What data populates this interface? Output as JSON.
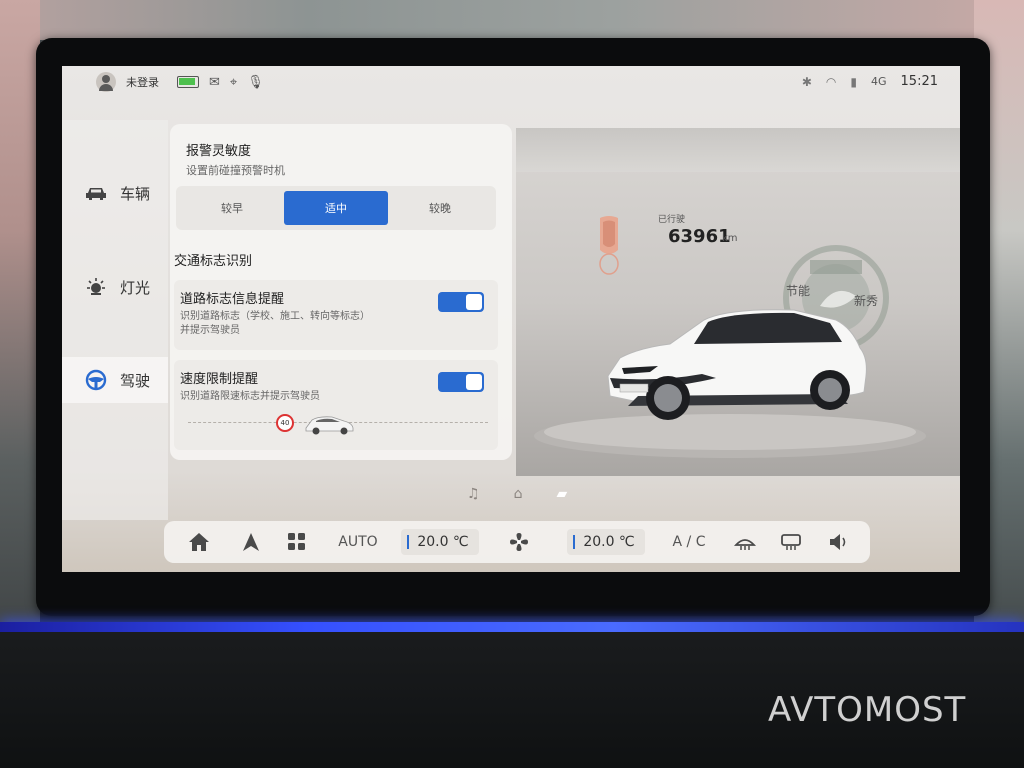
{
  "status_bar": {
    "login_label": "未登录",
    "icons": [
      "avatar-icon",
      "battery-icon",
      "mail-icon",
      "location-icon",
      "microphone-icon"
    ],
    "right_icons": [
      "bluetooth-icon",
      "wifi-icon",
      "signal-icon"
    ],
    "network": "4G",
    "time": "15:21"
  },
  "sidebar": {
    "items": [
      {
        "label": "车辆",
        "icon": "car-icon",
        "active": false
      },
      {
        "label": "灯光",
        "icon": "light-icon",
        "active": false
      },
      {
        "label": "驾驶",
        "icon": "steering-wheel-icon",
        "active": true
      }
    ]
  },
  "settings": {
    "alarm": {
      "title": "报警灵敏度",
      "subtitle": "设置前碰撞预警时机",
      "options": [
        "较早",
        "适中",
        "较晚"
      ],
      "selected": "适中"
    },
    "traffic_sign_section": "交通标志识别",
    "road_sign": {
      "title": "道路标志信息提醒",
      "desc_line1": "识别道路标志（学校、施工、转向等标志）",
      "desc_line2": "并提示驾驶员",
      "enabled": true
    },
    "speed_limit": {
      "title": "速度限制提醒",
      "desc": "识别道路限速标志并提示驾驶员",
      "enabled": true,
      "sign_value": "40"
    }
  },
  "vehicle": {
    "mileage_label": "已行驶",
    "mileage_value": "63961",
    "mileage_unit": "km",
    "badge_text_left": "节能",
    "badge_text_right": "新秀"
  },
  "dock": {
    "icons": [
      "music-icon",
      "home-icon",
      "car-dock-icon"
    ],
    "active": "car-dock-icon"
  },
  "climate": {
    "auto_label": "AUTO",
    "left_temp": "20.0 ℃",
    "right_temp": "20.0 ℃",
    "ac_label": "A / C"
  },
  "watermark": "AVTOMOST"
}
